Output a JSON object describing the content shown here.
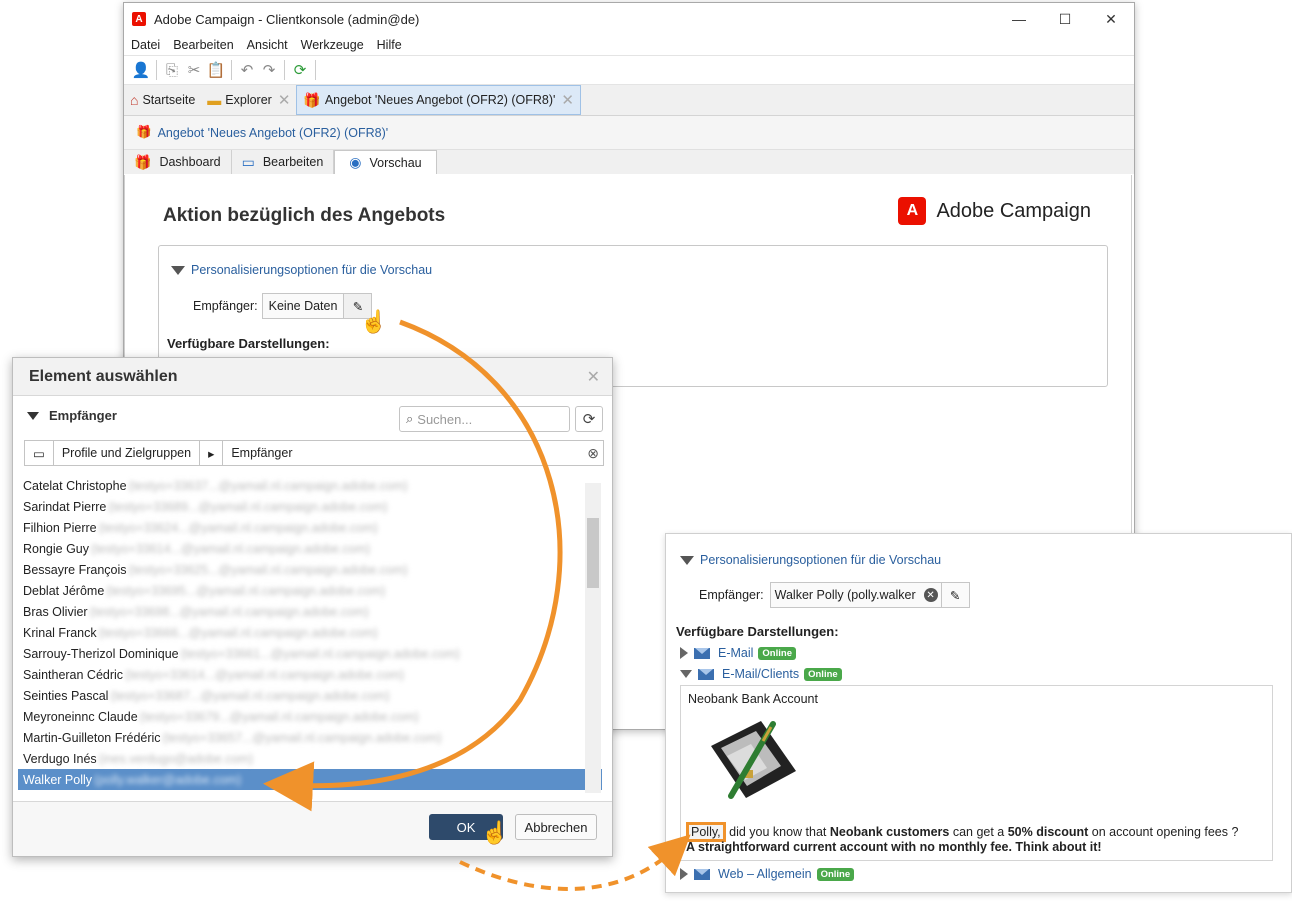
{
  "window": {
    "title": "Adobe Campaign - Clientkonsole (admin@de)",
    "menu": [
      "Datei",
      "Bearbeiten",
      "Ansicht",
      "Werkzeuge",
      "Hilfe"
    ],
    "tabs": [
      {
        "label": "Startseite"
      },
      {
        "label": "Explorer"
      },
      {
        "label": "Angebot 'Neues Angebot (OFR2) (OFR8)'"
      }
    ],
    "breadcrumb": "Angebot 'Neues Angebot (OFR2) (OFR8)'",
    "subtabs": [
      "Dashboard",
      "Bearbeiten",
      "Vorschau"
    ]
  },
  "main": {
    "title": "Aktion bezüglich des Angebots",
    "brand": "Adobe Campaign",
    "panel_title": "Personalisierungsoptionen für die Vorschau",
    "recipient_label": "Empfänger:",
    "recipient_value": "Keine Daten",
    "available_label": "Verfügbare Darstellungen:"
  },
  "dialog": {
    "title": "Element auswählen",
    "section": "Empfänger",
    "search_placeholder": "Suchen...",
    "path": [
      "Profile und Zielgruppen",
      "Empfänger"
    ],
    "rows": [
      {
        "name": "Catelat Christophe",
        "mail": "(testyo+33637...@yamail.nl.campaign.adobe.com)"
      },
      {
        "name": "Sarindat Pierre",
        "mail": "(testyo+33689...@yamail.nl.campaign.adobe.com)"
      },
      {
        "name": "Filhion Pierre",
        "mail": "(testyo+33624...@yamail.nl.campaign.adobe.com)"
      },
      {
        "name": "Rongie Guy",
        "mail": "(testyo+33614...@yamail.nl.campaign.adobe.com)"
      },
      {
        "name": "Bessayre François",
        "mail": "(testyo+33625...@yamail.nl.campaign.adobe.com)"
      },
      {
        "name": "Deblat Jérôme",
        "mail": "(testyo+33695...@yamail.nl.campaign.adobe.com)"
      },
      {
        "name": "Bras Olivier",
        "mail": "(testyo+33698...@yamail.nl.campaign.adobe.com)"
      },
      {
        "name": "Krinal Franck",
        "mail": "(testyo+33666...@yamail.nl.campaign.adobe.com)"
      },
      {
        "name": "Sarrouy-Therizol Dominique",
        "mail": "(testyo+33661...@yamail.nl.campaign.adobe.com)"
      },
      {
        "name": "Saintheran Cédric",
        "mail": "(testyo+33614...@yamail.nl.campaign.adobe.com)"
      },
      {
        "name": "Seinties Pascal",
        "mail": "(testyo+33687...@yamail.nl.campaign.adobe.com)"
      },
      {
        "name": "Meyroneinnc Claude",
        "mail": "(testyo+33679...@yamail.nl.campaign.adobe.com)"
      },
      {
        "name": "Martin-Guilleton Frédéric",
        "mail": "(testyo+33657...@yamail.nl.campaign.adobe.com)"
      },
      {
        "name": "Verdugo Inés",
        "mail": "(ines.verdugo@adobe.com)"
      },
      {
        "name": "Walker Polly",
        "mail": "(polly.walker@adobe.com)"
      }
    ],
    "ok": "OK",
    "cancel": "Abbrechen"
  },
  "result": {
    "panel_title": "Personalisierungsoptionen für die Vorschau",
    "recipient_label": "Empfänger:",
    "recipient_value": "Walker Polly (polly.walker",
    "available_label": "Verfügbare Darstellungen:",
    "reps": [
      {
        "label": "E-Mail",
        "badge": "Online"
      },
      {
        "label": "E-Mail/Clients",
        "badge": "Online"
      },
      {
        "label": "Web – Allgemein",
        "badge": "Online"
      }
    ],
    "mail_subject": "Neobank Bank Account",
    "body": {
      "name": "Polly,",
      "t1": " did you know that ",
      "b1": "Neobank customers",
      "t2": " can get a ",
      "b2": "50% discount",
      "t3": " on account opening fees ?",
      "line2": "A straightforward current account with no monthly fee. Think about it!"
    }
  },
  "colors": {
    "accent": "#2a5f9e",
    "brand": "#eb1000",
    "selection": "#5b8fc9",
    "highlight": "#f0922b",
    "online": "#4aa84a"
  }
}
